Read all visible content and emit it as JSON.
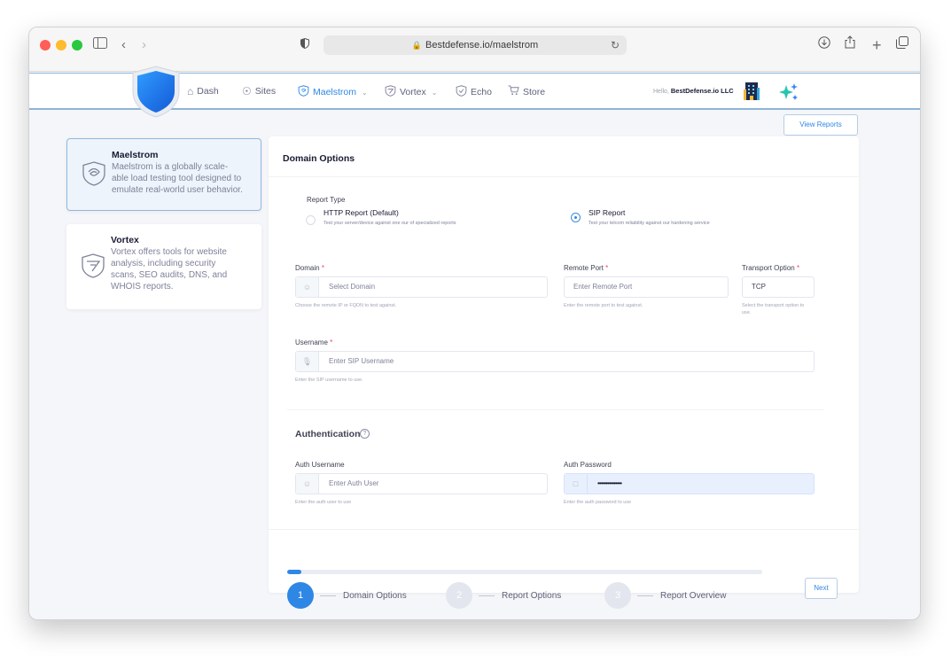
{
  "browser": {
    "url": "Bestdefense.io/maelstrom"
  },
  "nav": {
    "items": [
      {
        "label": "Dash",
        "icon": "home-icon"
      },
      {
        "label": "Sites",
        "icon": "globe-icon"
      },
      {
        "label": "Maelstrom",
        "icon": "maelstrom-icon",
        "active": true
      },
      {
        "label": "Vortex",
        "icon": "vortex-icon"
      },
      {
        "label": "Echo",
        "icon": "echo-icon"
      },
      {
        "label": "Store",
        "icon": "cart-icon"
      }
    ],
    "hello_prefix": "Hello,",
    "company": "BestDefense.io LLC"
  },
  "actions": {
    "view_reports": "View Reports"
  },
  "tools": [
    {
      "title": "Maelstrom",
      "description": "Maelstrom is a globally scale-able load testing tool designed to emulate real-world user behavior."
    },
    {
      "title": "Vortex",
      "description": "Vortex offers tools for website analysis, including security scans, SEO audits, DNS, and WHOIS reports."
    }
  ],
  "form": {
    "title": "Domain Options",
    "report_type": {
      "label": "Report Type",
      "options": [
        {
          "title": "HTTP Report (Default)",
          "desc": "Test your server/device against one our of specialized reports",
          "selected": false
        },
        {
          "title": "SIP Report",
          "desc": "Test your telcom reliability against our hardening service",
          "selected": true
        }
      ]
    },
    "domain": {
      "label": "Domain",
      "placeholder": "Select Domain",
      "hint": "Choose the remote IP or FQDN to test against."
    },
    "remote_port": {
      "label": "Remote Port",
      "placeholder": "Enter Remote Port",
      "hint": "Enter the remote port to test against."
    },
    "transport": {
      "label": "Transport Option",
      "value": "TCP",
      "hint": "Select the transport option to use."
    },
    "username": {
      "label": "Username",
      "placeholder": "Enter SIP Username",
      "hint": "Enter the SIP username to use."
    },
    "required_mark": "*",
    "auth": {
      "title": "Authentication",
      "help": "?",
      "username": {
        "label": "Auth Username",
        "placeholder": "Enter Auth User",
        "hint": "Enter the auth user to use"
      },
      "password": {
        "label": "Auth Password",
        "value": "•••••••••••••••",
        "hint": "Enter the auth password to use"
      }
    }
  },
  "stepper": {
    "progress": 0.03,
    "steps": [
      {
        "number": "1",
        "label": "Domain Options",
        "active": true
      },
      {
        "number": "2",
        "label": "Report Options",
        "active": false
      },
      {
        "number": "3",
        "label": "Report Overview",
        "active": false
      }
    ],
    "next_label": "Next"
  },
  "colors": {
    "accent": "#2e87e4",
    "required": "#f1416c",
    "step_inactive": "#e3e6ee"
  }
}
